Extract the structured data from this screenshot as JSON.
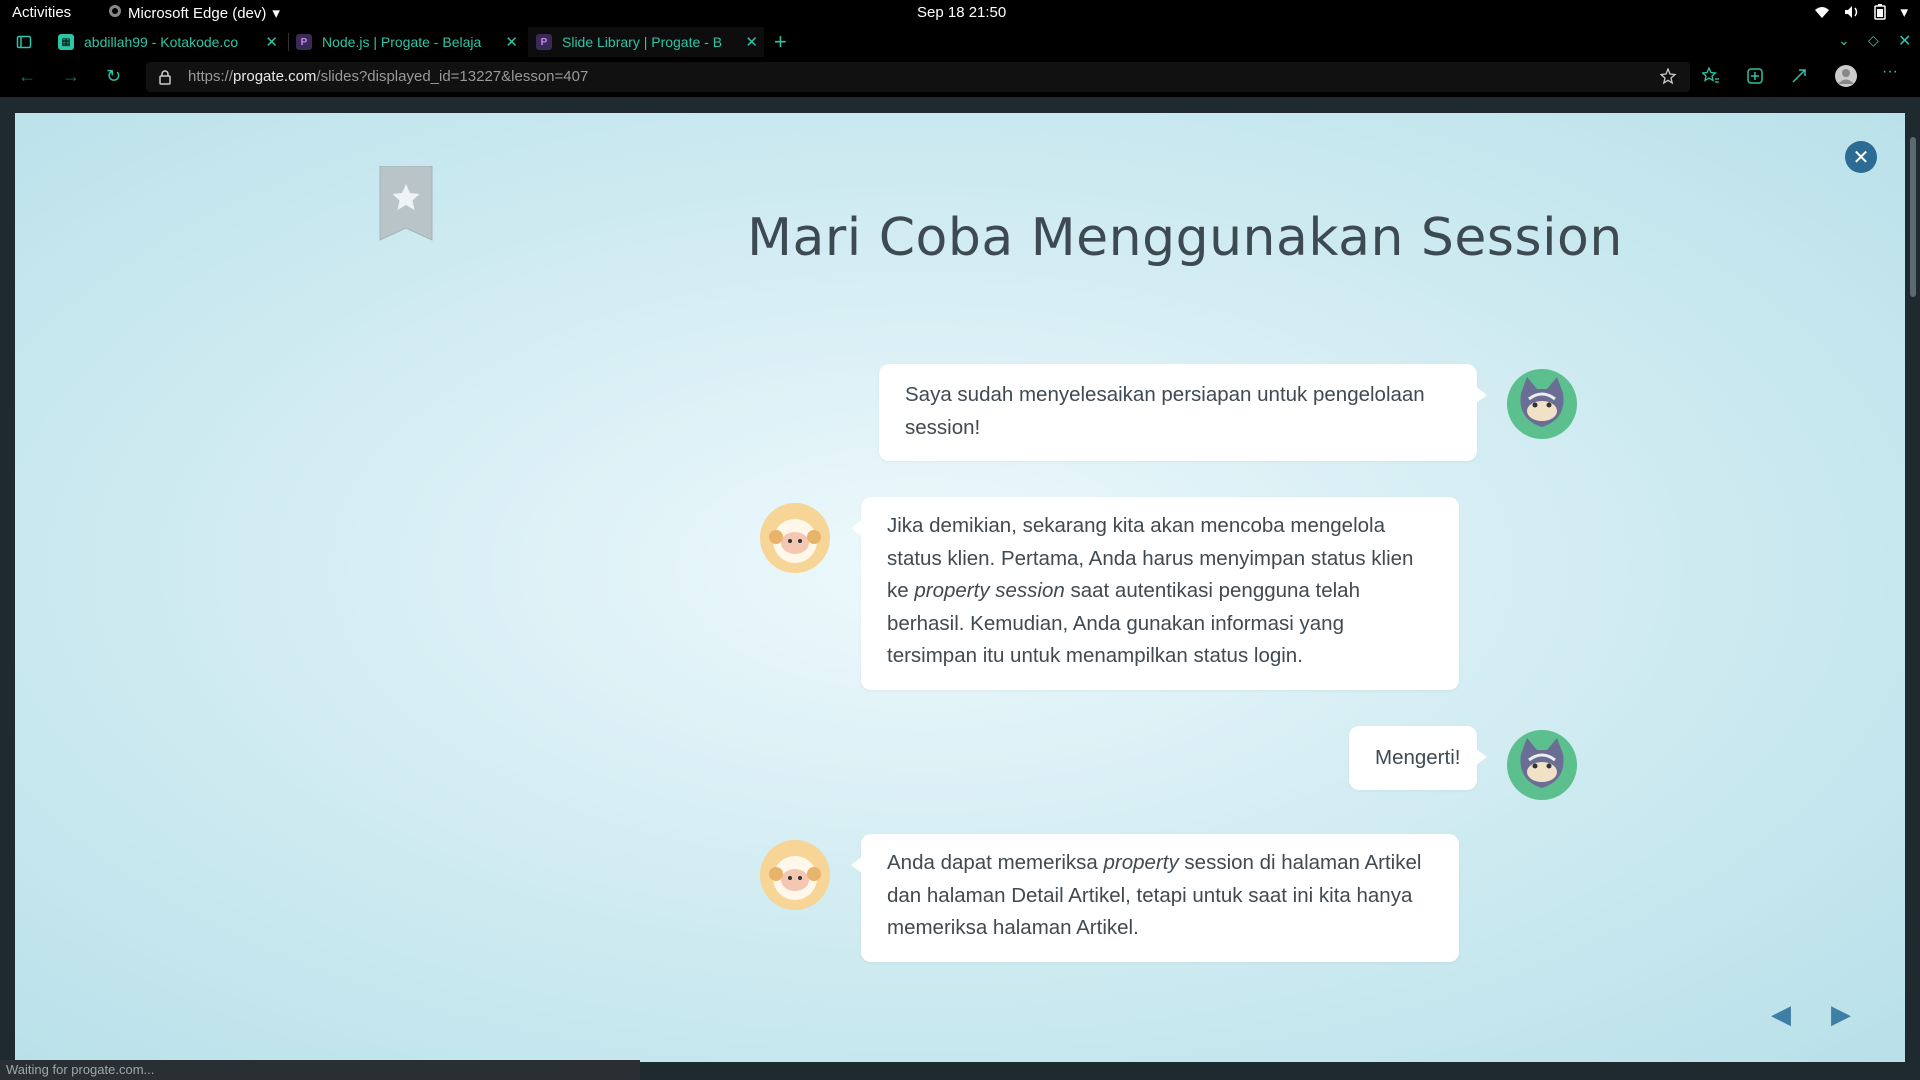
{
  "system": {
    "activities": "Activities",
    "app_name": "Microsoft Edge (dev)",
    "clock": "Sep 18  21:50"
  },
  "tabs": [
    {
      "title": "abdillah99 - Kotakode.co",
      "favicon": "kotakode-favicon"
    },
    {
      "title": "Node.js | Progate - Belaja",
      "favicon": "progate-favicon"
    },
    {
      "title": "Slide Library | Progate - B",
      "favicon": "progate-favicon"
    }
  ],
  "address": {
    "url_prefix": "https://",
    "url_host": "progate.com",
    "url_path": "/slides?displayed_id=13227&lesson=407"
  },
  "slide": {
    "title": "Mari Coba Menggunakan Session",
    "messages": [
      {
        "speaker": "cat",
        "text": "Saya sudah menyelesaikan persiapan untuk pengelolaan session!"
      },
      {
        "speaker": "sheep",
        "text_before": "Jika demikian, sekarang kita akan mencoba mengelola status klien. Pertama, Anda harus menyimpan status klien ke ",
        "emphasis": "property session",
        "text_after": " saat autentikasi pengguna telah berhasil. Kemudian, Anda gunakan informasi yang tersimpan itu untuk menampilkan status login."
      },
      {
        "speaker": "cat",
        "text": "Mengerti!"
      },
      {
        "speaker": "sheep",
        "text_before": "Anda dapat memeriksa ",
        "emphasis": "property",
        "text_after": " session di halaman Artikel dan halaman Detail Artikel, tetapi untuk saat ini kita hanya memeriksa halaman Artikel."
      }
    ],
    "prev_arrow": "◀",
    "next_arrow": "▶"
  },
  "status": "Waiting for progate.com...",
  "colors": {
    "accent": "#2ec4a6",
    "close": "#2c6c94",
    "arrow": "#3f7fa6"
  }
}
